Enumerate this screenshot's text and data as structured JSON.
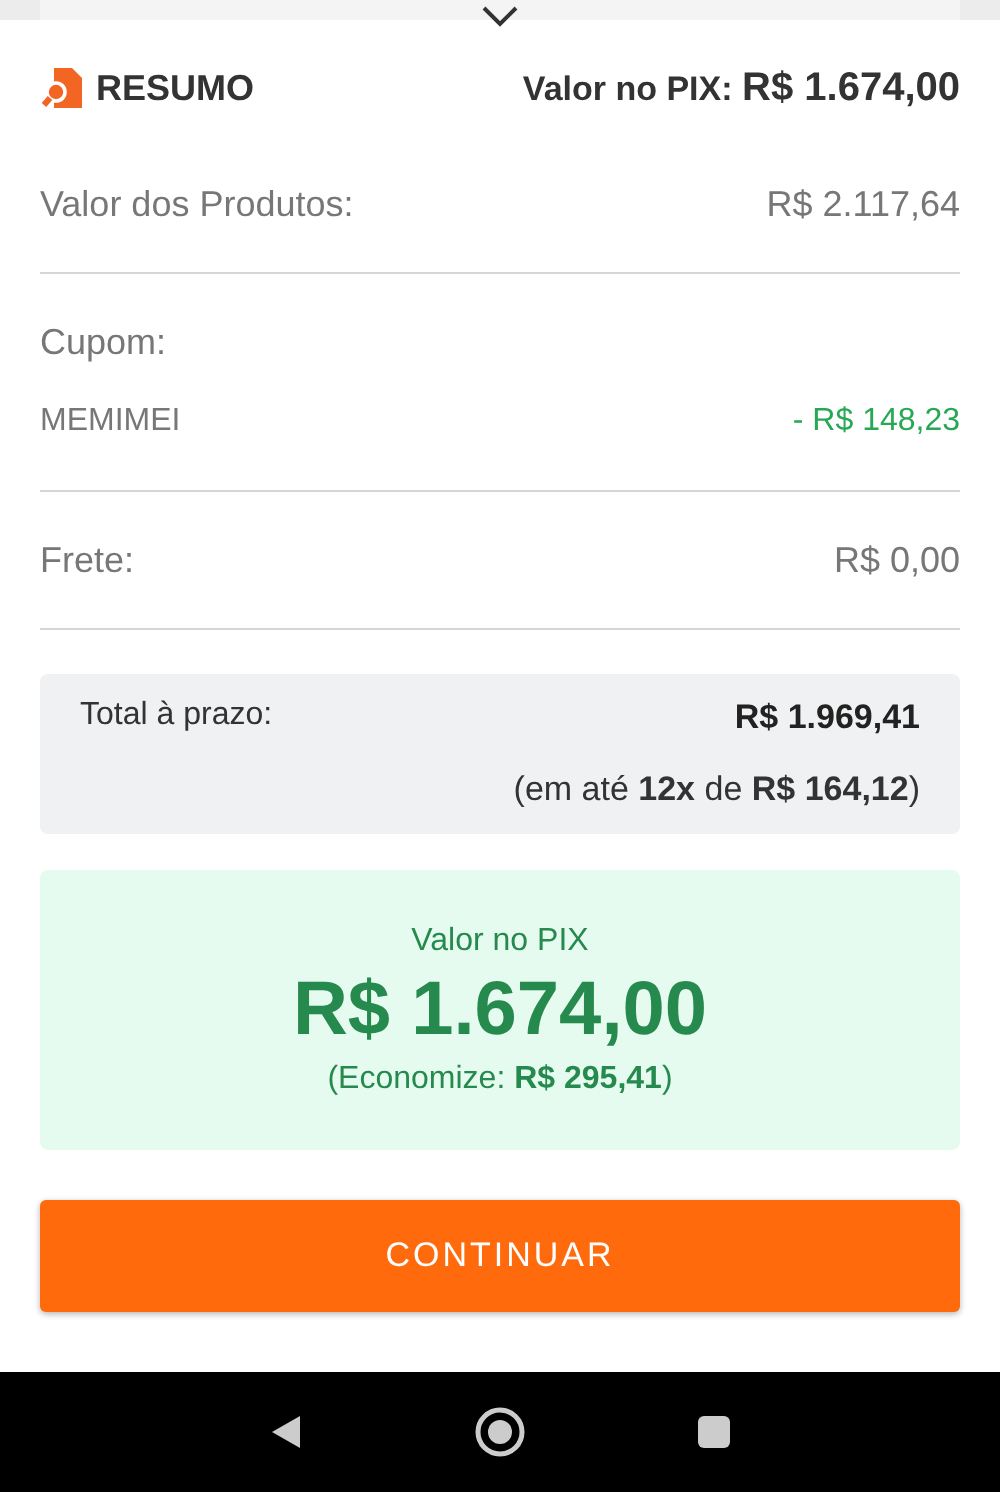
{
  "header": {
    "title": "RESUMO",
    "pix_label": "Valor no PIX:",
    "pix_value": "R$ 1.674,00"
  },
  "sections": [
    {
      "rows": [
        {
          "kind": "line",
          "label": "Valor dos Produtos:",
          "value": "R$ 2.117,64"
        }
      ]
    },
    {
      "rows": [
        {
          "kind": "heading",
          "label": "Cupom:"
        },
        {
          "kind": "discount",
          "label": "MEMIMEI",
          "value": "- R$ 148,23"
        }
      ]
    },
    {
      "rows": [
        {
          "kind": "line",
          "label": "Frete:",
          "value": "R$ 0,00"
        }
      ]
    }
  ],
  "installments": {
    "label": "Total à prazo:",
    "total": "R$ 1.969,41",
    "detail": "(em até **12x** de **R$ 164,12**)"
  },
  "pix": {
    "label": "Valor no PIX",
    "value": "R$ 1.674,00",
    "savings": "(Economize: **R$ 295,41**)"
  },
  "button": "CONTINUAR"
}
